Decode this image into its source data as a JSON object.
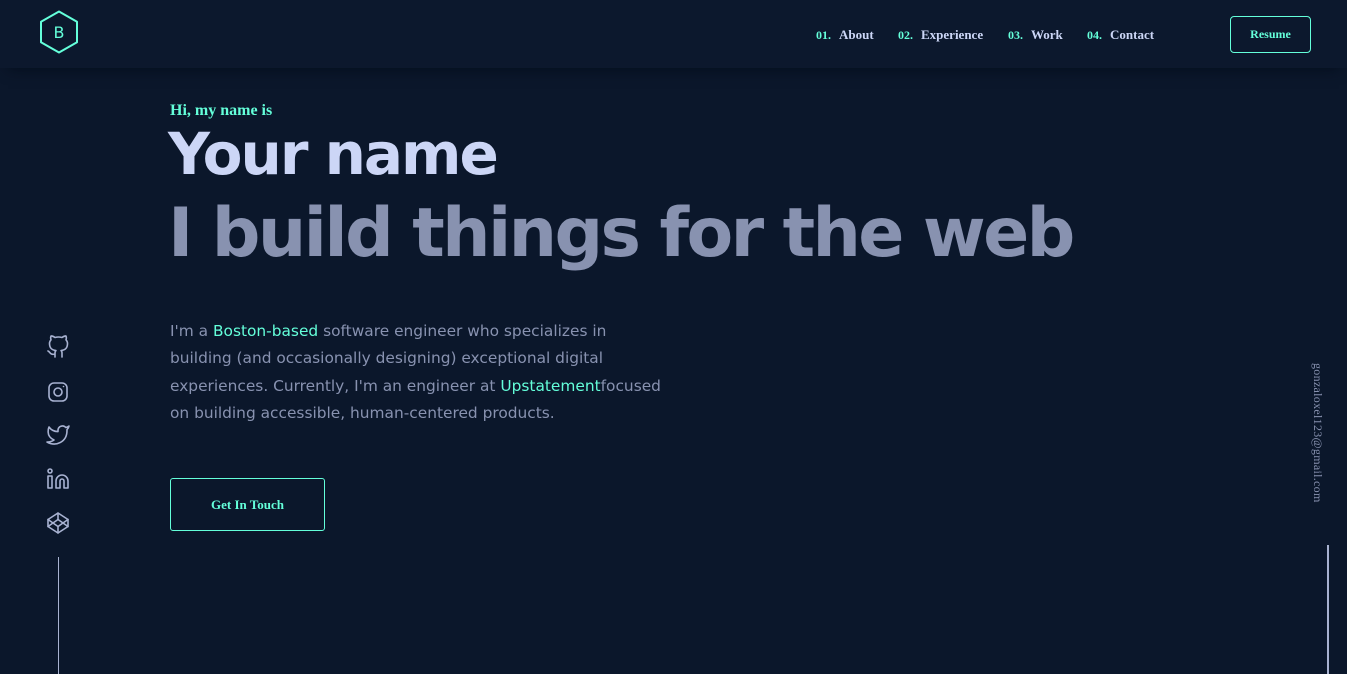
{
  "header": {
    "logo_letter": "B",
    "nav": [
      {
        "num": "01.",
        "label": "About"
      },
      {
        "num": "02.",
        "label": "Experience"
      },
      {
        "num": "03.",
        "label": "Work"
      },
      {
        "num": "04.",
        "label": "Contact"
      }
    ],
    "resume_label": "Resume"
  },
  "hero": {
    "greeting": "Hi, my name is",
    "name": "Your name",
    "tagline": "I build things for the web",
    "intro": {
      "part1": "I'm a ",
      "highlight1": "Boston-based",
      "part2": " software engineer who specializes in building (and occasionally designing) exceptional digital experiences. Currently, I'm an engineer at ",
      "highlight2": "Upstatement",
      "part3": "focused on building accessible, human-centered products."
    },
    "cta_label": "Get In Touch"
  },
  "socials": [
    {
      "icon": "github-icon"
    },
    {
      "icon": "instagram-icon"
    },
    {
      "icon": "twitter-icon"
    },
    {
      "icon": "linkedin-icon"
    },
    {
      "icon": "codepen-icon"
    }
  ],
  "email": "gonzaloxel123@gmail.com",
  "colors": {
    "background": "#0b172b",
    "accent": "#64ffda",
    "heading": "#ccd6f6",
    "muted": "#8892b0"
  }
}
